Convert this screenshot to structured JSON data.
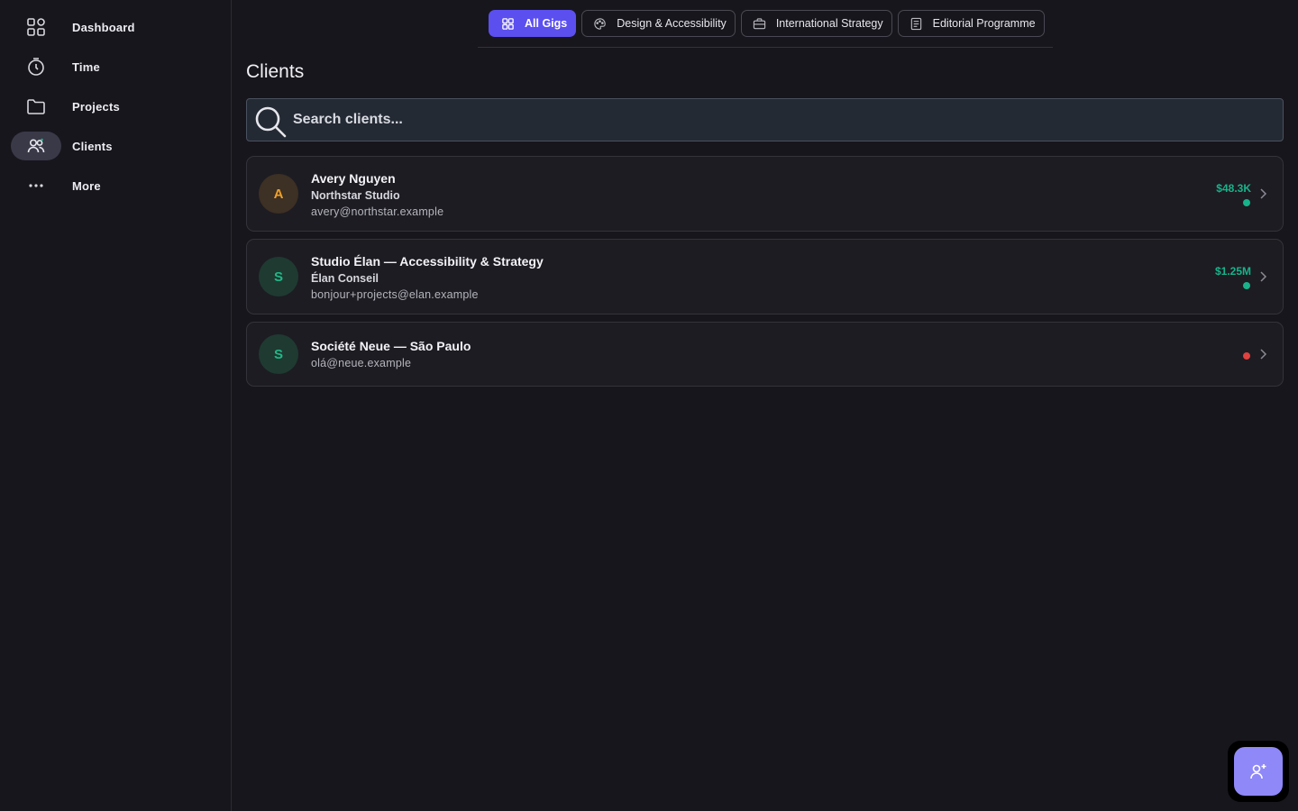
{
  "sidebar": {
    "items": [
      {
        "label": "Dashboard",
        "icon": "grid-icon"
      },
      {
        "label": "Time",
        "icon": "timer-icon"
      },
      {
        "label": "Projects",
        "icon": "folder-icon"
      },
      {
        "label": "Clients",
        "icon": "users-icon",
        "active": true
      },
      {
        "label": "More",
        "icon": "more-icon"
      }
    ]
  },
  "tabs": [
    {
      "label": "All Gigs",
      "icon": "grid-icon",
      "active": true
    },
    {
      "label": "Design & Accessibility",
      "icon": "palette-icon"
    },
    {
      "label": "International Strategy",
      "icon": "briefcase-icon"
    },
    {
      "label": "Editorial Programme",
      "icon": "document-icon"
    }
  ],
  "main": {
    "title": "Clients",
    "search_placeholder": "Search clients..."
  },
  "clients": [
    {
      "initial": "A",
      "name": "Avery Nguyen",
      "company": "Northstar Studio",
      "email": "avery@northstar.example",
      "amount": "$48.3K",
      "status": "green"
    },
    {
      "initial": "S",
      "name": "Studio Élan — Accessibility & Strategy",
      "company": "Élan Conseil",
      "email": "bonjour+projects@elan.example",
      "amount": "$1.25M",
      "status": "green"
    },
    {
      "initial": "S",
      "name": "Société Neue — São Paulo",
      "company": "",
      "email": "olá@neue.example",
      "amount": "",
      "status": "red"
    }
  ],
  "colors": {
    "accent": "#5b4ff0",
    "fab": "#8f88f8",
    "status_green": "#18b38a",
    "status_red": "#e0413f"
  },
  "fab": {
    "icon": "add-user-icon"
  }
}
